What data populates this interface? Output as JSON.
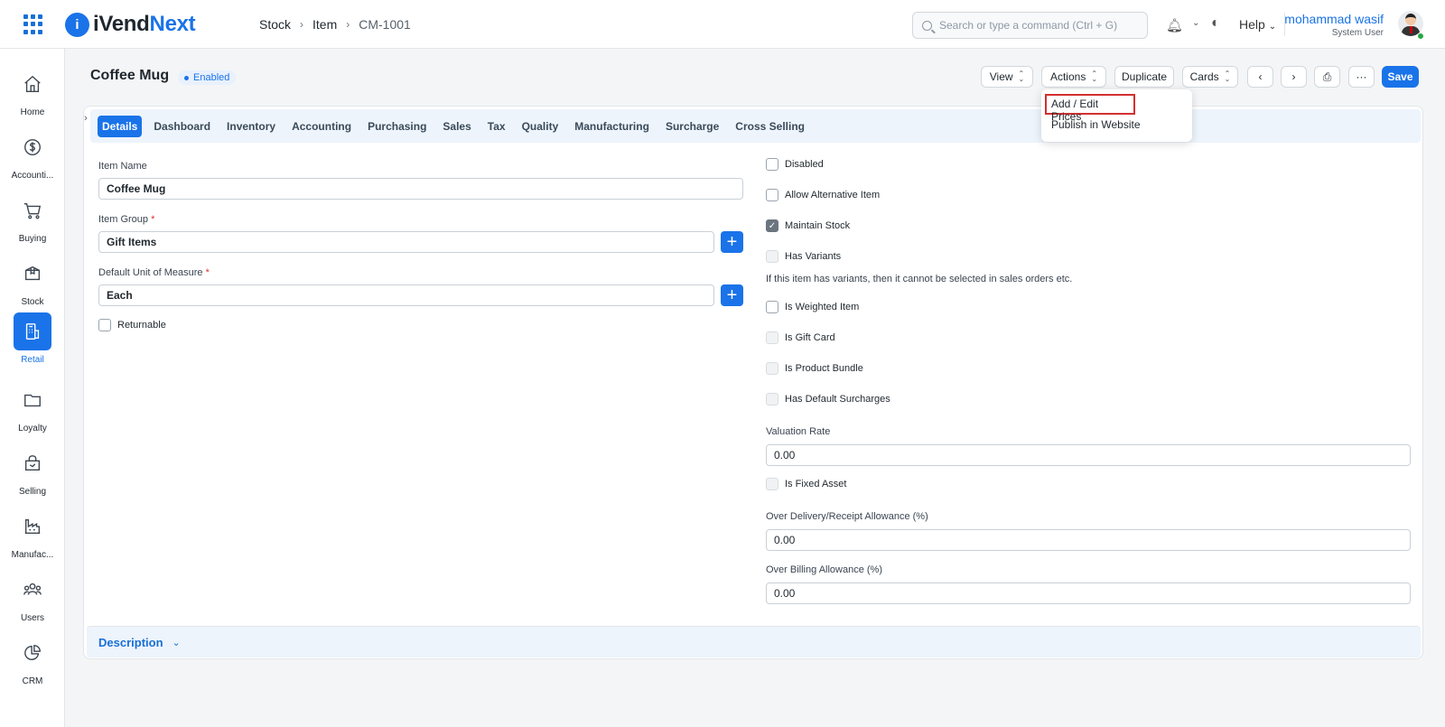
{
  "app": {
    "brand_prefix": "iVend",
    "brand_suffix": "Next"
  },
  "breadcrumb": [
    "Stock",
    "Item",
    "CM-1001"
  ],
  "search": {
    "placeholder": "Search or type a command (Ctrl + G)"
  },
  "topnav": {
    "help": "Help"
  },
  "user": {
    "name": "mohammad wasif",
    "role": "System User"
  },
  "sidebar": {
    "items": [
      {
        "label": "Home",
        "icon": "home-icon"
      },
      {
        "label": "Accounti...",
        "icon": "dollar-icon"
      },
      {
        "label": "Buying",
        "icon": "cart-icon"
      },
      {
        "label": "Stock",
        "icon": "box-icon"
      },
      {
        "label": "Retail",
        "icon": "pos-icon",
        "active": true
      },
      {
        "label": "Loyalty",
        "icon": "folder-icon"
      },
      {
        "label": "Selling",
        "icon": "bag-icon"
      },
      {
        "label": "Manufac...",
        "icon": "factory-icon"
      },
      {
        "label": "Users",
        "icon": "users-icon"
      },
      {
        "label": "CRM",
        "icon": "pie-icon"
      }
    ]
  },
  "page": {
    "title": "Coffee Mug",
    "status": "Enabled"
  },
  "toolbar": {
    "view": "View",
    "actions": "Actions",
    "duplicate": "Duplicate",
    "cards": "Cards",
    "more": "···",
    "save": "Save"
  },
  "actions_menu": {
    "items": [
      "Add / Edit Prices",
      "Publish in Website"
    ]
  },
  "tabs": [
    "Details",
    "Dashboard",
    "Inventory",
    "Accounting",
    "Purchasing",
    "Sales",
    "Tax",
    "Quality",
    "Manufacturing",
    "Surcharge",
    "Cross Selling"
  ],
  "form": {
    "item_name": {
      "label": "Item Name",
      "value": "Coffee Mug"
    },
    "item_group": {
      "label": "Item Group",
      "value": "Gift Items"
    },
    "uom": {
      "label": "Default Unit of Measure",
      "value": "Each"
    },
    "returnable": "Returnable",
    "checks": {
      "disabled": "Disabled",
      "alt_item": "Allow Alternative Item",
      "maintain_stock": "Maintain Stock",
      "has_variants": "Has Variants",
      "variants_note": "If this item has variants, then it cannot be selected in sales orders etc.",
      "weighted": "Is Weighted Item",
      "gift_card": "Is Gift Card",
      "bundle": "Is Product Bundle",
      "surcharges": "Has Default Surcharges",
      "fixed_asset": "Is Fixed Asset"
    },
    "valuation_rate": {
      "label": "Valuation Rate",
      "value": "0.00"
    },
    "over_delivery": {
      "label": "Over Delivery/Receipt Allowance (%)",
      "value": "0.00"
    },
    "over_billing": {
      "label": "Over Billing Allowance (%)",
      "value": "0.00"
    }
  },
  "section": {
    "description": "Description"
  },
  "colors": {
    "accent": "#1a73e8",
    "highlight_border": "#d32f2f"
  }
}
